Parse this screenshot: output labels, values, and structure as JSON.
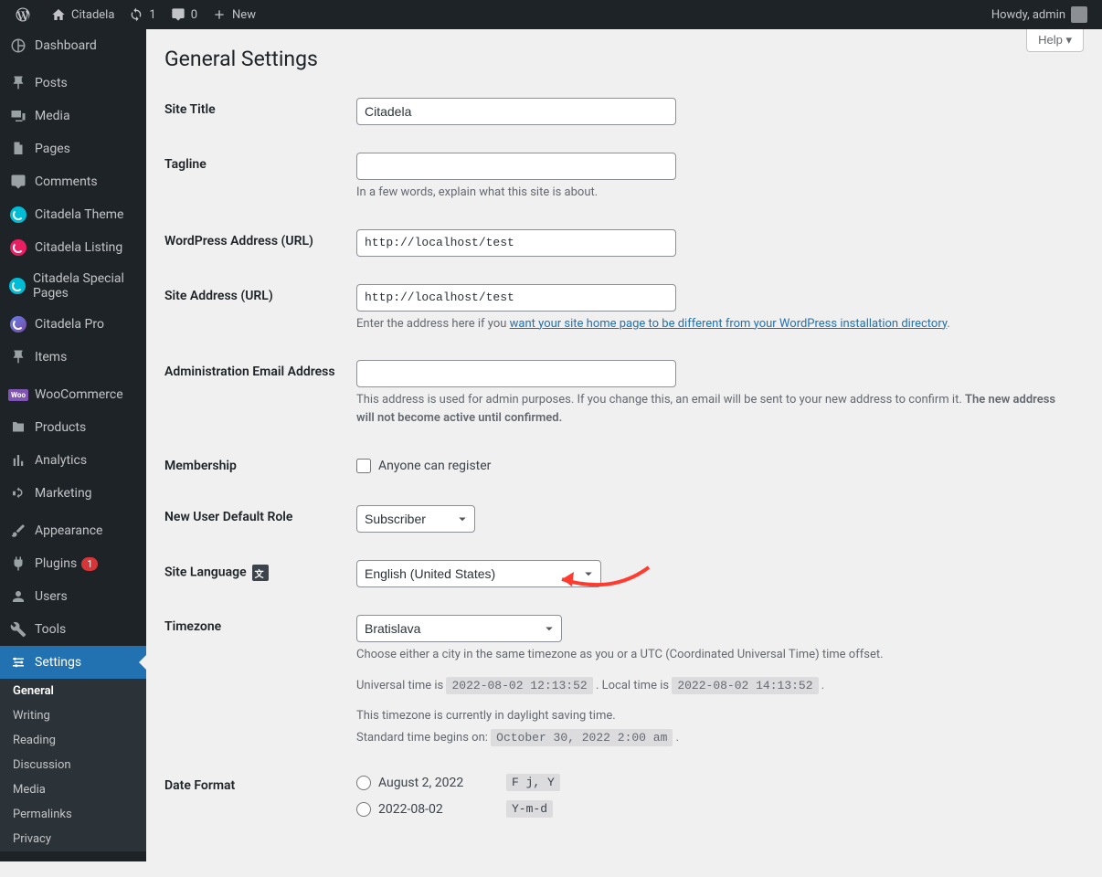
{
  "toolbar": {
    "site_name": "Citadela",
    "updates": "1",
    "comments": "0",
    "new": "New",
    "howdy": "Howdy, admin"
  },
  "menu": {
    "dashboard": "Dashboard",
    "posts": "Posts",
    "media": "Media",
    "pages": "Pages",
    "comments": "Comments",
    "citadela_theme": "Citadela Theme",
    "citadela_listing": "Citadela Listing",
    "citadela_special": "Citadela Special Pages",
    "citadela_pro": "Citadela Pro",
    "items": "Items",
    "woocommerce": "WooCommerce",
    "products": "Products",
    "analytics": "Analytics",
    "marketing": "Marketing",
    "appearance": "Appearance",
    "plugins": "Plugins",
    "plugins_count": "1",
    "users": "Users",
    "tools": "Tools",
    "settings": "Settings"
  },
  "submenu": {
    "general": "General",
    "writing": "Writing",
    "reading": "Reading",
    "discussion": "Discussion",
    "media": "Media",
    "permalinks": "Permalinks",
    "privacy": "Privacy"
  },
  "screen": {
    "help": "Help"
  },
  "page": {
    "title": "General Settings"
  },
  "fields": {
    "site_title": {
      "label": "Site Title",
      "value": "Citadela"
    },
    "tagline": {
      "label": "Tagline",
      "value": "",
      "desc": "In a few words, explain what this site is about."
    },
    "wp_url": {
      "label": "WordPress Address (URL)",
      "value": "http://localhost/test"
    },
    "site_url": {
      "label": "Site Address (URL)",
      "value": "http://localhost/test",
      "desc_pre": "Enter the address here if you ",
      "desc_link": "want your site home page to be different from your WordPress installation directory",
      "desc_post": "."
    },
    "admin_email": {
      "label": "Administration Email Address",
      "value": "",
      "desc_pre": "This address is used for admin purposes. If you change this, an email will be sent to your new address to confirm it. ",
      "desc_strong": "The new address will not become active until confirmed."
    },
    "membership": {
      "label": "Membership",
      "checkbox": "Anyone can register"
    },
    "default_role": {
      "label": "New User Default Role",
      "value": "Subscriber"
    },
    "language": {
      "label": "Site Language",
      "value": "English (United States)"
    },
    "timezone": {
      "label": "Timezone",
      "value": "Bratislava",
      "desc1": "Choose either a city in the same timezone as you or a UTC (Coordinated Universal Time) time offset.",
      "utc_pre": "Universal time is ",
      "utc_code": "2022-08-02 12:13:52",
      "utc_mid": " . Local time is ",
      "local_code": "2022-08-02 14:13:52",
      "utc_post": " .",
      "dst": "This timezone is currently in daylight saving time.",
      "std_pre": "Standard time begins on: ",
      "std_code": "October 30, 2022 2:00 am",
      "std_post": " ."
    },
    "date_format": {
      "label": "Date Format",
      "opt1_label": "August 2, 2022",
      "opt1_code": "F j, Y",
      "opt2_label": "2022-08-02",
      "opt2_code": "Y-m-d"
    }
  }
}
